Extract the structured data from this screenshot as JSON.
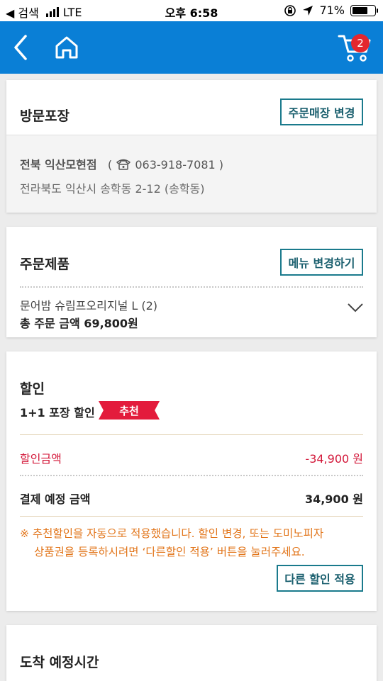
{
  "status_bar": {
    "back_label": "◀ 검색",
    "network": "LTE",
    "time": "오후 6:58",
    "battery": "71%",
    "battery_level": 0.71
  },
  "header": {
    "cart_count": "2",
    "colors": {
      "background": "#0a7fd6",
      "badge": "#e4262e"
    }
  },
  "pickup": {
    "title": "방문포장",
    "change_store_label": "주문매장 변경",
    "store_name": "전북 익산모현점",
    "phone_open": "(",
    "phone": "063-918-7081",
    "phone_close": ")",
    "address": "전라북도 익산시 송학동 2-12 (송학동)"
  },
  "order": {
    "title": "주문제품",
    "change_menu_label": "메뉴 변경하기",
    "item": "문어밤 슈림프오리지널 L (2)",
    "total": "총 주문 금액 69,800원"
  },
  "discount": {
    "title": "할인",
    "applied_name": "1+1 포장 할인",
    "badge": "추천",
    "discount_label": "할인금액",
    "discount_value": "-34,900 원",
    "payment_label": "결제 예정 금액",
    "payment_value": "34,900 원",
    "note_line1": "※ 추천할인을 자동으로 적용했습니다. 할인 변경, 또는 도미노피자",
    "note_line2": "상품권을 등록하시려면 ‘다른할인 적용’ 버튼을 눌러주세요.",
    "other_discount_label": "다른 할인 적용",
    "colors": {
      "accent_red": "#d3183a",
      "note_orange": "#e2751a",
      "button_teal": "#1a7a8c"
    }
  },
  "arrival": {
    "title": "도착 예정시간"
  }
}
